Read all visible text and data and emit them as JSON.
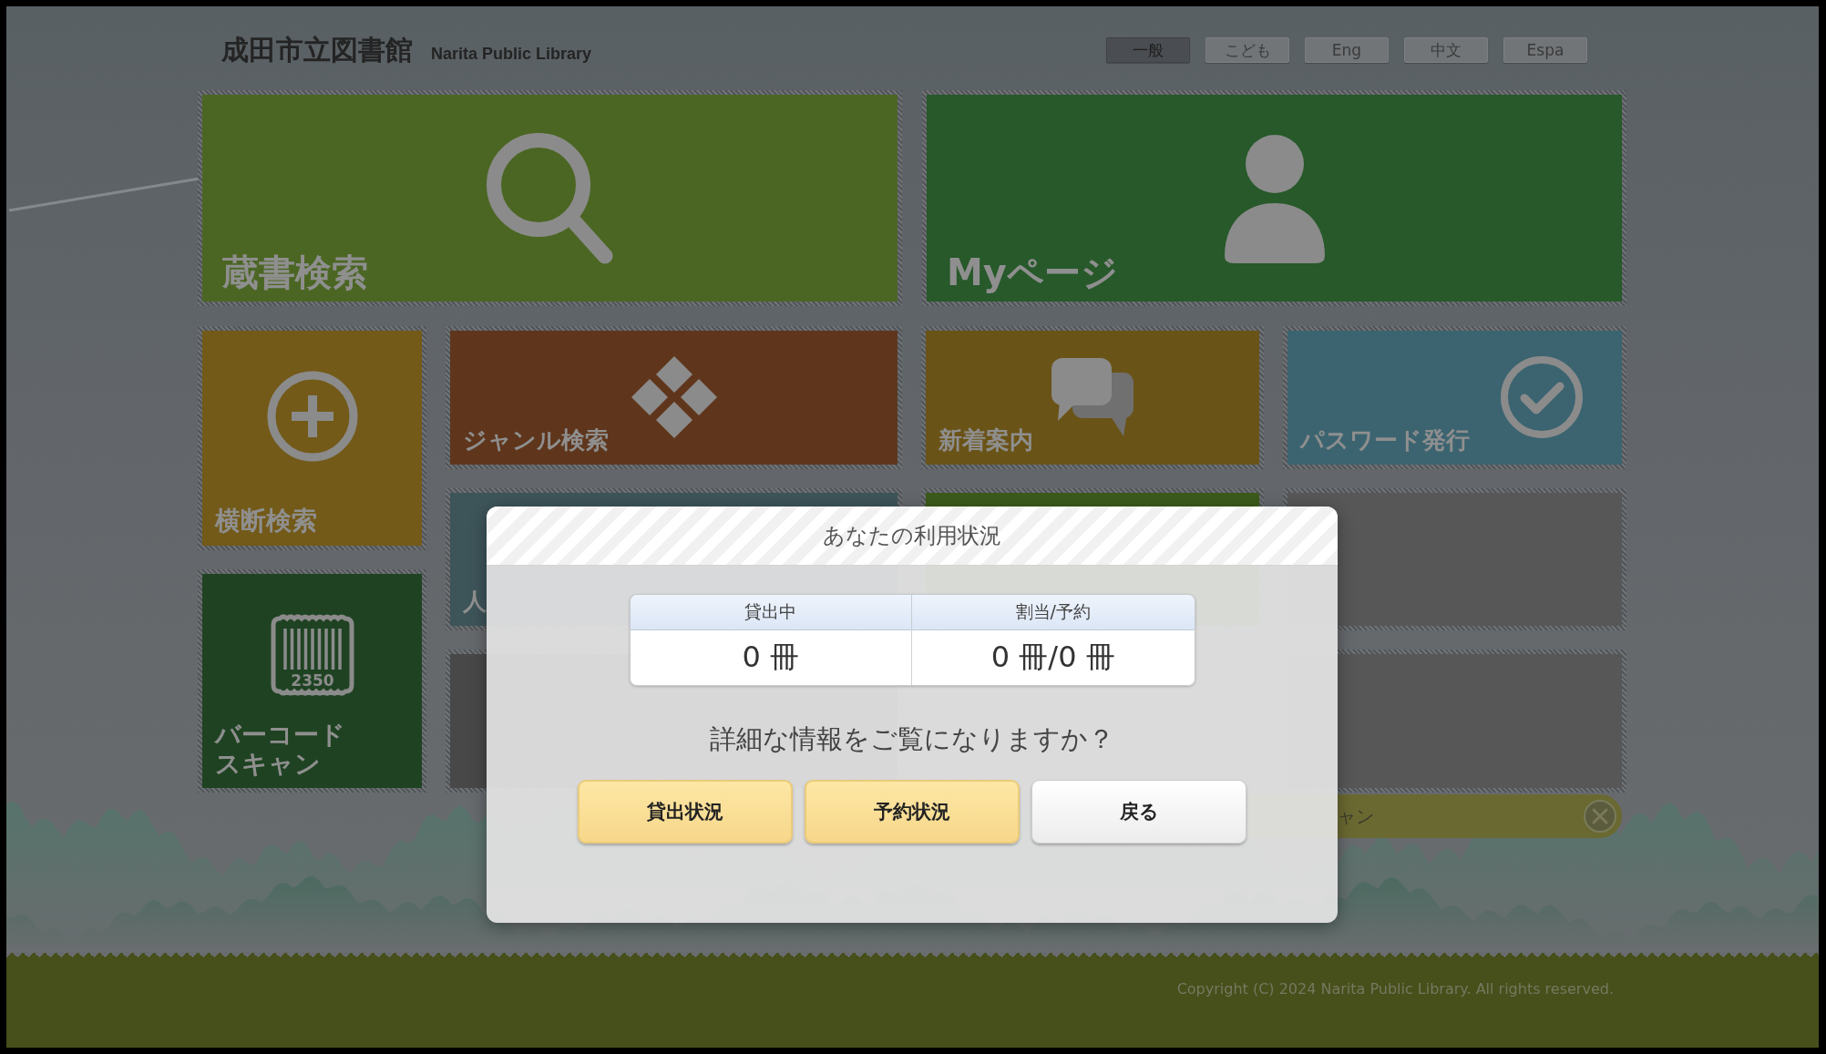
{
  "header": {
    "title": "成田市立図書館",
    "subtitle": "Narita Public Library",
    "languages": [
      {
        "label": "一般",
        "selected": true
      },
      {
        "label": "こども",
        "selected": false
      },
      {
        "label": "Eng",
        "selected": false
      },
      {
        "label": "中文",
        "selected": false
      },
      {
        "label": "Espa",
        "selected": false
      }
    ]
  },
  "feature_tiles": [
    {
      "label": "蔵書検索",
      "color": "#4b6623"
    },
    {
      "label": "Myページ",
      "color": "#27592a"
    }
  ],
  "side_tiles": [
    {
      "label": "横断検索",
      "color": "#735a19"
    },
    {
      "label": "バーコードスキャン",
      "color": "#1f4322",
      "icon_text": "2350"
    }
  ],
  "grid_tiles": [
    {
      "kind": "caption",
      "label": "ジャンル検索",
      "color": "#5f361c"
    },
    {
      "kind": "caption",
      "label": "新着案内",
      "color": "#6a5317"
    },
    {
      "kind": "caption",
      "label": "パスワード発行",
      "color": "#3b6470"
    },
    {
      "kind": "caption",
      "label": "人",
      "color": "#3d5459"
    },
    {
      "kind": "blank",
      "color": "#3c5a1c"
    },
    {
      "kind": "blank",
      "color": "#575757"
    },
    {
      "kind": "blank",
      "color": "#484848"
    },
    {
      "kind": "blank",
      "color": "#575757"
    }
  ],
  "card_scan": {
    "placeholder": "ャン"
  },
  "dialog": {
    "title": "あなたの利用状況",
    "table": {
      "columns": [
        "貸出中",
        "割当/予約"
      ],
      "values": [
        "0 冊",
        "0 冊/0 冊"
      ]
    },
    "question": "詳細な情報をご覧になりますか？",
    "buttons": [
      {
        "label": "貸出状況",
        "kind": "primary"
      },
      {
        "label": "予約状況",
        "kind": "primary"
      },
      {
        "label": "戻る",
        "kind": "secondary"
      }
    ]
  },
  "footer": {
    "copyright": "Copyright (C) 2024 Narita Public Library. All rights reserved."
  }
}
